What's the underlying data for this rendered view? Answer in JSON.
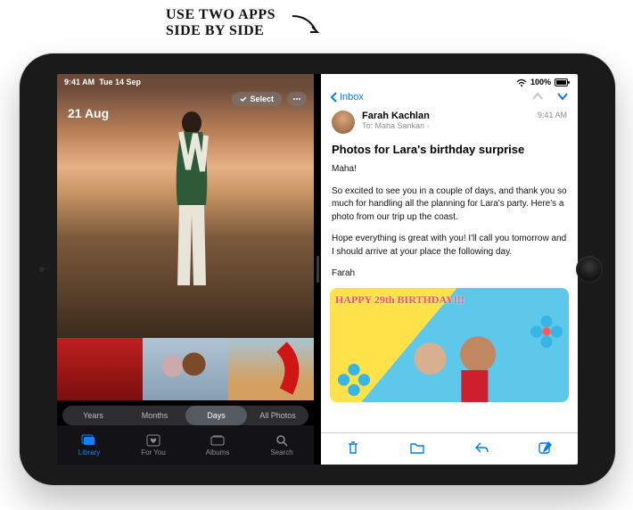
{
  "callout": "USE TWO APPS\nSIDE BY SIDE",
  "colors": {
    "ios_blue": "#007aff",
    "ios_gray": "#8e8e93"
  },
  "statusbar": {
    "time": "9:41 AM",
    "date": "Tue 14 Sep",
    "battery": "100%",
    "wifi_icon": "wifi-icon"
  },
  "photos_app": {
    "name": "Photos",
    "hero_title": "21 Aug",
    "select_label": "Select",
    "more_icon": "ellipsis-icon",
    "segments": [
      "Years",
      "Months",
      "Days",
      "All Photos"
    ],
    "selected_segment": "Days",
    "tabs": [
      {
        "label": "Library",
        "icon": "photo-stack-icon",
        "selected": true
      },
      {
        "label": "For You",
        "icon": "heart-square-icon",
        "selected": false
      },
      {
        "label": "Albums",
        "icon": "albums-icon",
        "selected": false
      },
      {
        "label": "Search",
        "icon": "search-icon",
        "selected": false
      }
    ]
  },
  "mail_app": {
    "name": "Mail",
    "back_label": "Inbox",
    "prev_icon": "chevron-up-icon",
    "next_icon": "chevron-down-icon",
    "message": {
      "sender": "Farah Kachlan",
      "to_label": "To:",
      "recipient": "Maha Sankari",
      "time": "9:41 AM",
      "subject": "Photos for Lara's birthday surprise",
      "paragraphs": [
        "Maha!",
        "So excited to see you in a couple of days, and thank you so much for handling all the planning for Lara's party. Here's a photo from our trip up the coast.",
        "Hope everything is great with you! I'll call you tomorrow and I should arrive at your place the following day.",
        "Farah"
      ],
      "attachment_overlay": "HAPPY 29th BIRTHDAY!!!"
    },
    "toolbar_icons": [
      "trash-icon",
      "folder-icon",
      "reply-icon",
      "compose-icon"
    ]
  }
}
